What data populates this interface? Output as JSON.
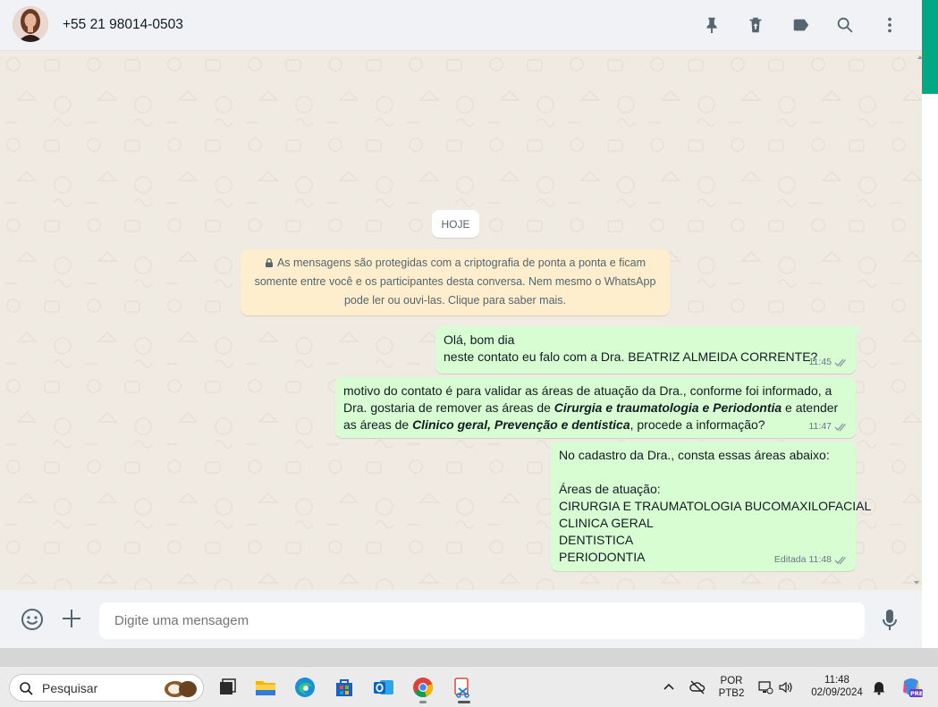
{
  "header": {
    "contact": "+55 21 98014-0503",
    "icons": [
      "pin-icon",
      "delete-icon",
      "label-icon",
      "search-icon",
      "menu-icon"
    ]
  },
  "chat": {
    "date_chip": "HOJE",
    "encryption_notice": {
      "line1": "As mensagens são protegidas com a criptografia de ponta a ponta e ficam",
      "line2": "somente entre você e os participantes desta conversa. Nem mesmo o WhatsApp",
      "line3": "pode ler ou ouvi-las. Clique para saber mais."
    },
    "messages": [
      {
        "line1": "Olá, bom dia",
        "line2": "neste contato eu falo com a Dra. BEATRIZ ALMEIDA CORRENTE?",
        "time": "11:45"
      },
      {
        "l1": "motivo do contato é para validar as áreas de atuação da Dra., conforme foi informado, a",
        "l2a": "Dra. gostaria de remover as áreas de ",
        "l2b": "Cirurgia e traumatologia e Periodontia",
        "l2c": " e atender",
        "l3a": "as áreas de ",
        "l3b": "Clinico geral, Prevenção e dentistica",
        "l3c": ", procede a informação?",
        "time": "11:47"
      },
      {
        "l1": "No cadastro da Dra., consta essas áreas abaixo:",
        "l2": "Áreas de atuação:",
        "l3": "CIRURGIA E TRAUMATOLOGIA BUCOMAXILOFACIAL",
        "l4": "CLINICA GERAL",
        "l5": "DENTISTICA",
        "l6": "PERIODONTIA",
        "edited": "Editada",
        "time": "11:48"
      }
    ]
  },
  "compose": {
    "placeholder": "Digite uma mensagem"
  },
  "taskbar": {
    "search_label": "Pesquisar",
    "lang_line1": "POR",
    "lang_line2": "PTB2",
    "time": "11:48",
    "date": "02/09/2024",
    "copilot_badge": "PRE"
  },
  "colors": {
    "accent": "#00a884",
    "outgoing_bubble": "#d9fdd3",
    "encryption_bg": "#ffeecd",
    "chat_bg": "#efeae2",
    "tick_blue": "#53bdeb"
  }
}
